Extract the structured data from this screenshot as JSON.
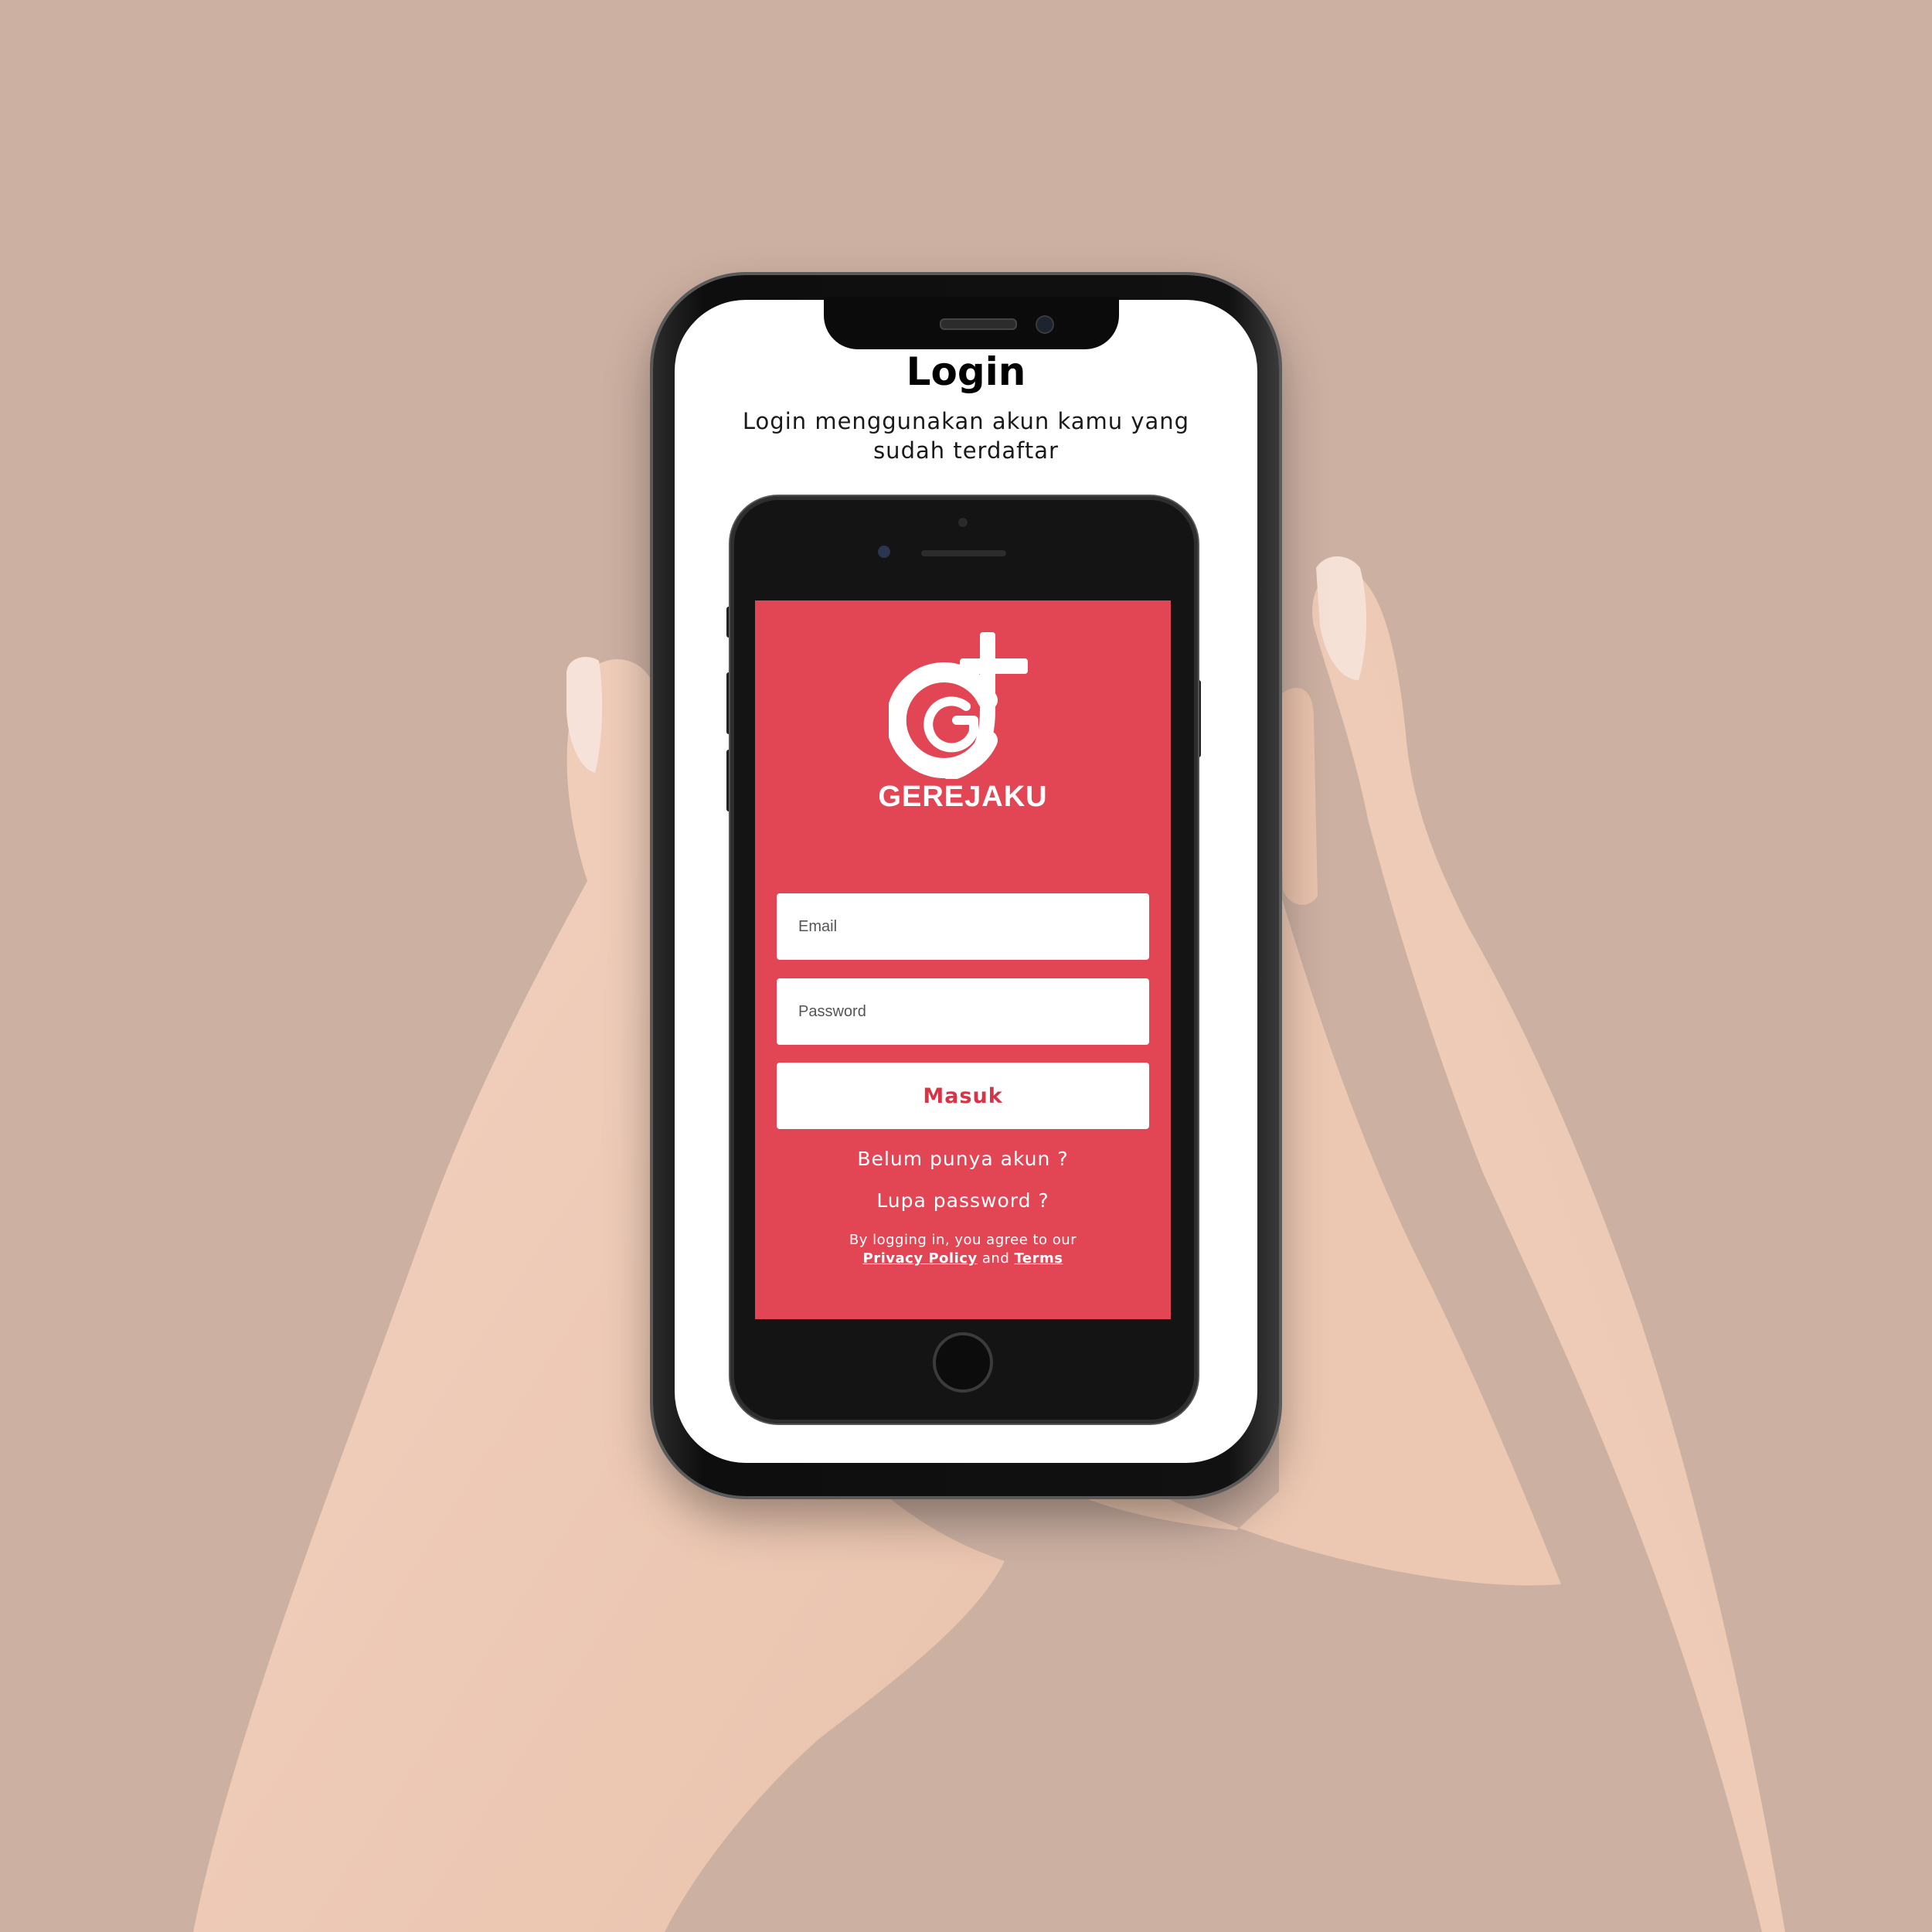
{
  "page": {
    "title": "Login",
    "subtitle": "Login menggunakan akun kamu yang sudah terdaftar"
  },
  "app": {
    "brand_name": "GEREJAKU",
    "logo_icon": "gerejaku-logo-icon",
    "email": {
      "placeholder": "Email",
      "value": ""
    },
    "password": {
      "placeholder": "Password",
      "value": ""
    },
    "submit_label": "Masuk",
    "register_link": "Belum punya akun ?",
    "forgot_link": "Lupa password ?",
    "legal": {
      "prefix": "By logging in, you agree to our",
      "privacy": "Privacy Policy",
      "and": "and",
      "terms": "Terms"
    }
  },
  "colors": {
    "background": "#ccb0a2",
    "accent_red": "#e24655",
    "button_text": "#d83447"
  }
}
